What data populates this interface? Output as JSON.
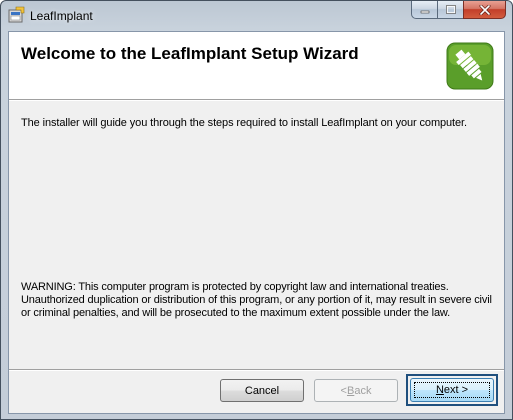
{
  "window": {
    "title": "LeafImplant"
  },
  "banner": {
    "title": "Welcome to the LeafImplant Setup Wizard"
  },
  "content": {
    "intro": "The installer will guide you through the steps required to install LeafImplant on your computer.",
    "warning": "WARNING: This computer program is protected by copyright law and international treaties. Unauthorized duplication or distribution of this program, or any portion of it, may result in severe civil or criminal penalties, and will be prosecuted to the maximum extent possible under the law."
  },
  "buttons": {
    "cancel": "Cancel",
    "back_mnemonic": "B",
    "back_rest": "ack",
    "back_prefix": "< ",
    "next_mnemonic": "N",
    "next_rest": "ext >"
  },
  "icons": {
    "app": "installer-icon",
    "logo": "leafimplant-logo",
    "minimize": "minimize-icon",
    "maximize": "maximize-icon",
    "close": "close-icon"
  },
  "colors": {
    "logo_green": "#5a9e2a",
    "close_red": "#c23e2a",
    "focus_blue": "#3c7fb1"
  }
}
